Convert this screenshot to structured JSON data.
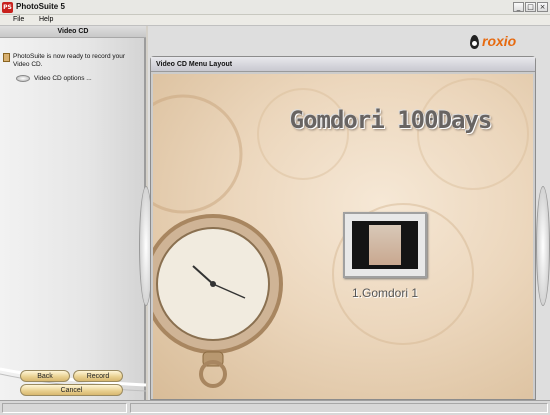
{
  "window": {
    "title": "PhotoSuite 5",
    "app_icon_text": "PS",
    "minimize_glyph": "_",
    "maximize_glyph": "□",
    "close_glyph": "×"
  },
  "menu": {
    "items": [
      {
        "label": "File"
      },
      {
        "label": "Help"
      }
    ]
  },
  "left_panel": {
    "header": "Video CD",
    "message": "PhotoSuite is now ready to record your Video CD.",
    "option_label": "Video CD options ...",
    "buttons": {
      "back": "Back",
      "record": "Record",
      "cancel": "Cancel"
    }
  },
  "main": {
    "logo_text": "roxio",
    "frame_title": "Video CD Menu Layout",
    "menu_title": "Gomdori 100Days",
    "items": [
      {
        "label": "1.Gomdori 1"
      }
    ]
  },
  "colors": {
    "brand_accent": "#e66a10",
    "button_fill": "#e8cf8e",
    "canvas_bg": "#ecd7bd"
  }
}
